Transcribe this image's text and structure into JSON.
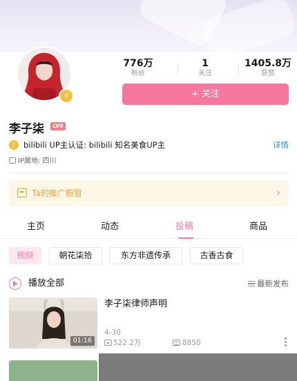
{
  "stats": [
    {
      "value": "776万",
      "label": "粉丝"
    },
    {
      "value": "1",
      "label": "关注"
    },
    {
      "value": "1405.8万",
      "label": "获赞"
    }
  ],
  "follow_button": "+ 关注",
  "profile": {
    "name": "李子柒",
    "level": "LV6",
    "certification": "bilibili UP主认证: bilibili 知名美食UP主",
    "cert_more": "详情",
    "ip": "IP属地: 四川"
  },
  "promo_window": {
    "label": "Ta的推广橱窗",
    "chevron": "›"
  },
  "tabs": [
    "主页",
    "动态",
    "投稿",
    "商品"
  ],
  "active_tab": "投稿",
  "filter_chips": [
    "视频",
    "朝花柒拾",
    "东方非遗传承",
    "古香古食"
  ],
  "play_all": "播放全部",
  "sort_label": "最新发布",
  "video": {
    "title": "李子柒律师声明",
    "duration": "01:16",
    "date": "4-30",
    "plays": "522.2万",
    "danmaku": "8850"
  },
  "colors": {
    "accent": "#f7779f",
    "gold": "#f4c13c",
    "link": "#2f8fc6",
    "promo_text": "#e3a246"
  }
}
